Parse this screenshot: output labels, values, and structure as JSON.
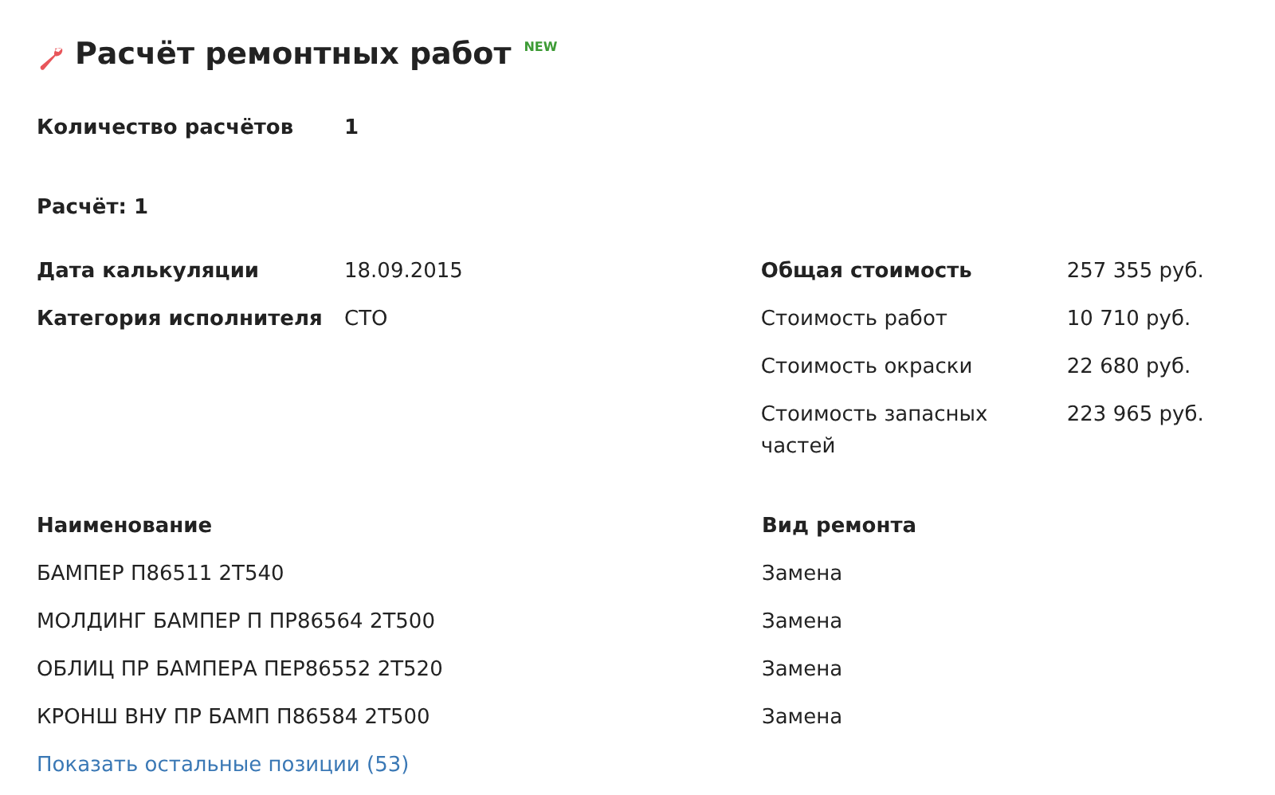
{
  "header": {
    "title": "Расчёт ремонтных работ",
    "badge": "NEW"
  },
  "count": {
    "label": "Количество расчётов",
    "value": "1"
  },
  "calc_title": "Расчёт: 1",
  "details": [
    {
      "label": "Дата калькуляции",
      "value": "18.09.2015"
    },
    {
      "label": "Категория исполнителя",
      "value": "СТО"
    }
  ],
  "costs": [
    {
      "kind": "total",
      "label": "Общая стоимость",
      "value": "257 355 руб."
    },
    {
      "kind": "item",
      "label": "Стоимость работ",
      "value": "10 710 руб."
    },
    {
      "kind": "item",
      "label": "Стоимость окраски",
      "value": "22 680 руб."
    },
    {
      "kind": "item",
      "label": "Стоимость запасных частей",
      "value": "223 965 руб."
    }
  ],
  "table": {
    "columns": [
      "Наименование",
      "Вид ремонта"
    ],
    "rows": [
      [
        "БАМПЕР П86511 2Т540",
        "Замена"
      ],
      [
        "МОЛДИНГ БАМПЕР П ПР86564 2Т500",
        "Замена"
      ],
      [
        "ОБЛИЦ ПР БАМПЕРА ПЕР86552 2Т520",
        "Замена"
      ],
      [
        "КРОНШ ВНУ ПР БАМП П86584 2Т500",
        "Замена"
      ]
    ]
  },
  "more_link": "Показать остальные позиции (53)"
}
